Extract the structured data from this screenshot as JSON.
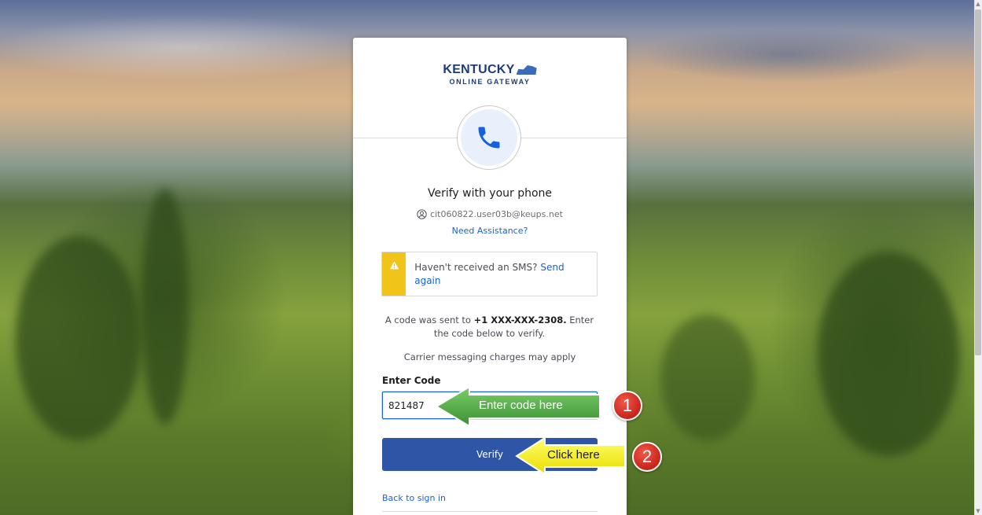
{
  "logo": {
    "title": "KENTUCKY",
    "subtitle": "ONLINE GATEWAY"
  },
  "page": {
    "title": "Verify with your phone",
    "username": "cit060822.user03b@keups.net",
    "assistance_link": "Need Assistance?"
  },
  "callout": {
    "text": "Haven't received an SMS?",
    "link": "Send again"
  },
  "sent_message": {
    "prefix": "A code was sent to",
    "phone": "+1 XXX-XXX-2308.",
    "suffix": "Enter the code below to verify."
  },
  "charges_text": "Carrier messaging charges may apply",
  "code_field": {
    "label": "Enter Code",
    "value": "821487"
  },
  "verify_button": "Verify",
  "back_link": "Back to sign in",
  "annotations": {
    "step1_label": "Enter code here",
    "step1_number": "1",
    "step2_label": "Click here",
    "step2_number": "2"
  },
  "colors": {
    "brand_blue": "#2f55a6",
    "link_blue": "#1662dd",
    "warning_yellow": "#f0c419",
    "arrow_green": "#4aa64a",
    "arrow_yellow": "#f5f20a",
    "badge_red": "#d42b1f"
  },
  "icons": {
    "phone": "phone-icon",
    "user": "user-circle-icon",
    "warning": "warning-icon"
  }
}
